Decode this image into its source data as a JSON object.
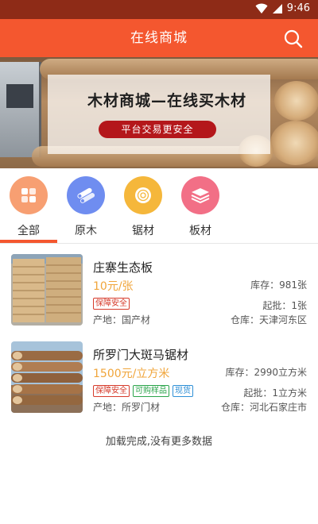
{
  "status": {
    "time": "9:46"
  },
  "header": {
    "title": "在线商城"
  },
  "banner": {
    "headline": "木材商城—在线买木材",
    "subline": "平台交易更安全"
  },
  "categories": [
    {
      "label": "全部",
      "icon": "grid-icon",
      "color": "#f79f72",
      "selected": true
    },
    {
      "label": "原木",
      "icon": "log-icon",
      "color": "#6f8df0",
      "selected": false
    },
    {
      "label": "锯材",
      "icon": "sawn-wood-icon",
      "color": "#f5b73b",
      "selected": false
    },
    {
      "label": "板材",
      "icon": "board-stack-icon",
      "color": "#f26f86",
      "selected": false
    }
  ],
  "products": [
    {
      "name": "庄寨生态板",
      "price": "10元/张",
      "stock": "库存：981张",
      "tags": [
        {
          "text": "保障安全",
          "style": "red"
        }
      ],
      "min_order": "起批：1张",
      "origin": "产地：国产材",
      "warehouse": "仓库：天津河东区"
    },
    {
      "name": "所罗门大斑马锯材",
      "price": "1500元/立方米",
      "stock": "库存：2990立方米",
      "tags": [
        {
          "text": "保障安全",
          "style": "red"
        },
        {
          "text": "可购样品",
          "style": "green"
        },
        {
          "text": "现货",
          "style": "blue"
        }
      ],
      "min_order": "起批：1立方米",
      "origin": "产地：所罗门材",
      "warehouse": "仓库：河北石家庄市"
    }
  ],
  "footer": {
    "note": "加载完成,没有更多数据"
  },
  "colors": {
    "accent": "#f4572f",
    "status_bar": "#8e2b17",
    "price": "#f0a53b"
  }
}
